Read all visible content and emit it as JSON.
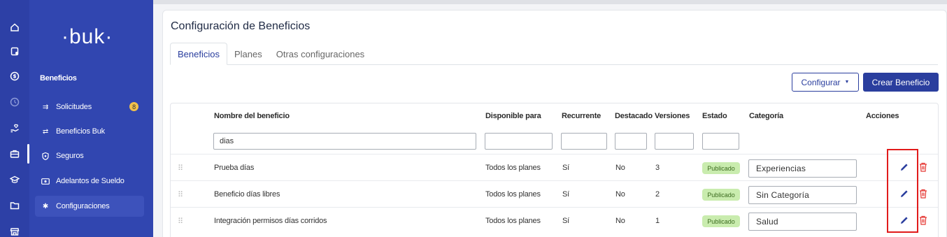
{
  "rail_icons": [
    "home-icon",
    "clipboard-icon",
    "dollar-icon",
    "clock-icon",
    "hand-heart-icon",
    "briefcase-icon",
    "graduation-icon",
    "folder-icon",
    "store-icon"
  ],
  "sidebar": {
    "logo": "·buk·",
    "section_title": "Beneficios",
    "items": [
      {
        "label": "Solicitudes",
        "icon": "swap-icon",
        "badge": "8"
      },
      {
        "label": "Beneficios Buk",
        "icon": "arrows-icon"
      },
      {
        "label": "Seguros",
        "icon": "shield-icon"
      },
      {
        "label": "Adelantos de Sueldo",
        "icon": "money-icon"
      },
      {
        "label": "Configuraciones",
        "icon": "gear-icon",
        "active": true
      }
    ]
  },
  "page": {
    "title": "Configuración de Beneficios",
    "tabs": [
      {
        "label": "Beneficios",
        "active": true
      },
      {
        "label": "Planes"
      },
      {
        "label": "Otras configuraciones"
      }
    ],
    "configure_button": "Configurar",
    "create_button": "Crear Beneficio"
  },
  "table": {
    "headers": {
      "name": "Nombre del beneficio",
      "available": "Disponible para",
      "recurring": "Recurrente",
      "featured": "Destacado",
      "versions": "Versiones",
      "status": "Estado",
      "category": "Categoría",
      "actions": "Acciones"
    },
    "filter_name_value": "dias",
    "rows": [
      {
        "name": "Prueba días",
        "available": "Todos los planes",
        "recurring": "Sí",
        "featured": "No",
        "versions": "3",
        "status": "Publicado",
        "category": "Experiencias"
      },
      {
        "name": "Beneficio días libres",
        "available": "Todos los planes",
        "recurring": "Sí",
        "featured": "No",
        "versions": "2",
        "status": "Publicado",
        "category": "Sin Categoría"
      },
      {
        "name": "Integración permisos días corridos",
        "available": "Todos los planes",
        "recurring": "Sí",
        "featured": "No",
        "versions": "1",
        "status": "Publicado",
        "category": "Salud"
      }
    ]
  },
  "colors": {
    "sidebar": "#3146b0",
    "primary": "#2a3e9e",
    "published_badge": "#c9ecae",
    "delete": "#e53935",
    "highlight": "#e11b1b"
  }
}
